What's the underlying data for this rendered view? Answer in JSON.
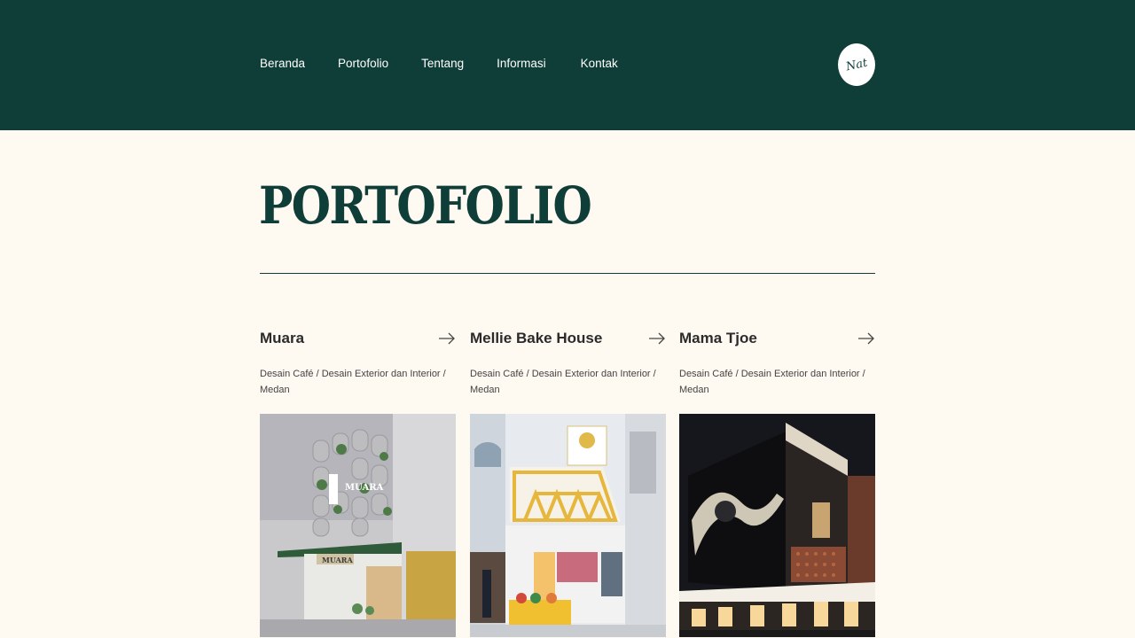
{
  "nav": {
    "items": [
      "Beranda",
      "Portofolio",
      "Tentang",
      "Informasi",
      "Kontak"
    ],
    "logo_text": "Nat"
  },
  "page": {
    "title": "PORTOFOLIO"
  },
  "projects": [
    {
      "title": "Muara",
      "description": "Desain Café / Desain Exterior dan Interior / Medan",
      "sign_text": "MUARA"
    },
    {
      "title": "Mellie Bake House",
      "description": "Desain Café / Desain Exterior dan Interior / Medan"
    },
    {
      "title": "Mama Tjoe",
      "description": "Desain Café / Desain Exterior dan Interior / Medan"
    }
  ],
  "colors": {
    "primary": "#0f3d38",
    "background": "#fef9f1",
    "text": "#2b2b2b"
  },
  "icons": {
    "arrow": "arrow-right-icon"
  }
}
